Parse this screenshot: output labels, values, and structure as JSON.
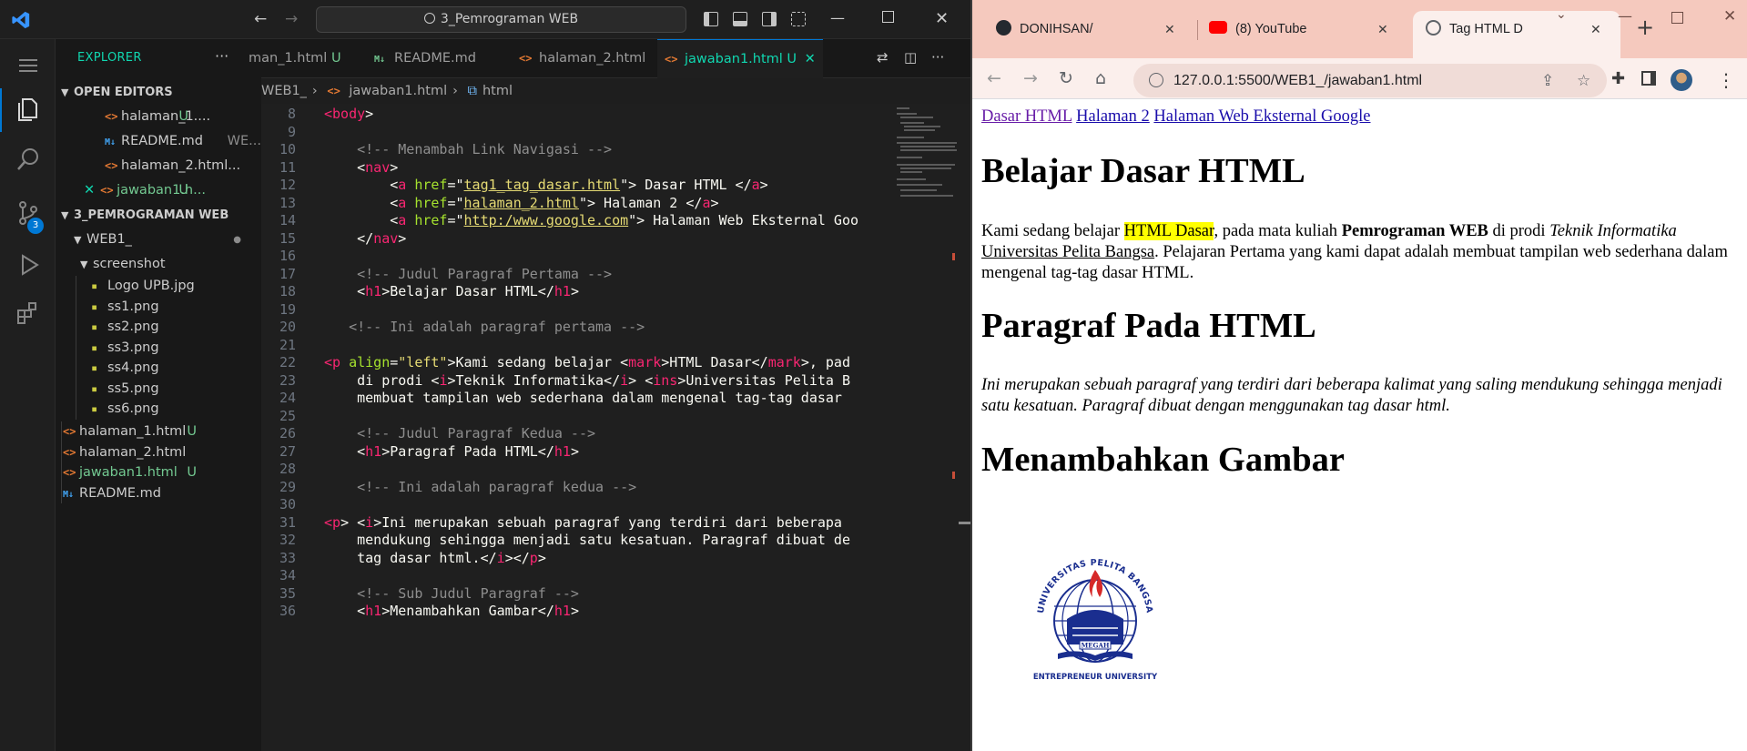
{
  "vscode": {
    "search_title": "3_Pemrograman WEB",
    "explorer_title": "EXPLORER",
    "open_editors_title": "OPEN EDITORS",
    "open_editors": [
      {
        "name": "halaman_1....",
        "flag": "U"
      },
      {
        "name": "README.md",
        "flag": "WE..."
      },
      {
        "name": "halaman_2.html...",
        "flag": ""
      },
      {
        "name": "jawaban1.h...",
        "flag": "U"
      }
    ],
    "project_title": "3_PEMROGRAMAN WEB",
    "folder_web1": "WEB1_",
    "folder_screenshot": "screenshot",
    "screenshot_files": [
      "Logo UPB.jpg",
      "ss1.png",
      "ss2.png",
      "ss3.png",
      "ss4.png",
      "ss5.png",
      "ss6.png"
    ],
    "root_files": [
      {
        "name": "halaman_1.html",
        "flag": "U"
      },
      {
        "name": "halaman_2.html",
        "flag": ""
      },
      {
        "name": "jawaban1.html",
        "flag": "U"
      },
      {
        "name": "README.md",
        "flag": ""
      }
    ],
    "scm_badge": "3",
    "tabs": [
      {
        "name": "man_1.html",
        "flag": "U"
      },
      {
        "name": "README.md",
        "flag": ""
      },
      {
        "name": "halaman_2.html",
        "flag": ""
      },
      {
        "name": "jawaban1.html",
        "flag": "U"
      }
    ],
    "breadcrumb": [
      "WEB1_",
      "jawaban1.html",
      "html"
    ],
    "code_lines": [
      {
        "n": "8",
        "segs": [
          [
            "t-tag",
            "<body"
          ],
          [
            "t-txt",
            ">"
          ]
        ]
      },
      {
        "n": "9",
        "segs": []
      },
      {
        "n": "10",
        "segs": [
          [
            "t-com",
            "    <!-- Menambah Link Navigasi -->"
          ]
        ]
      },
      {
        "n": "11",
        "segs": [
          [
            "t-txt",
            "    <"
          ],
          [
            "t-tag",
            "nav"
          ],
          [
            "t-txt",
            ">"
          ]
        ]
      },
      {
        "n": "12",
        "segs": [
          [
            "t-txt",
            "        <"
          ],
          [
            "t-tag",
            "a"
          ],
          [
            "t-txt",
            " "
          ],
          [
            "t-attr",
            "href"
          ],
          [
            "t-txt",
            "=\""
          ],
          [
            "t-str-u",
            "tag1_tag_dasar.html"
          ],
          [
            "t-txt",
            "\"> Dasar HTML </"
          ],
          [
            "t-tag",
            "a"
          ],
          [
            "t-txt",
            ">"
          ]
        ]
      },
      {
        "n": "13",
        "segs": [
          [
            "t-txt",
            "        <"
          ],
          [
            "t-tag",
            "a"
          ],
          [
            "t-txt",
            " "
          ],
          [
            "t-attr",
            "href"
          ],
          [
            "t-txt",
            "=\""
          ],
          [
            "t-str-u",
            "halaman_2.html"
          ],
          [
            "t-txt",
            "\"> Halaman 2 </"
          ],
          [
            "t-tag",
            "a"
          ],
          [
            "t-txt",
            ">"
          ]
        ]
      },
      {
        "n": "14",
        "segs": [
          [
            "t-txt",
            "        <"
          ],
          [
            "t-tag",
            "a"
          ],
          [
            "t-txt",
            " "
          ],
          [
            "t-attr",
            "href"
          ],
          [
            "t-txt",
            "=\""
          ],
          [
            "t-str-u",
            "http:/www.google.com"
          ],
          [
            "t-txt",
            "\"> Halaman Web Eksternal Goo"
          ]
        ]
      },
      {
        "n": "15",
        "segs": [
          [
            "t-txt",
            "    </"
          ],
          [
            "t-tag",
            "nav"
          ],
          [
            "t-txt",
            ">"
          ]
        ]
      },
      {
        "n": "16",
        "segs": []
      },
      {
        "n": "17",
        "segs": [
          [
            "t-com",
            "    <!-- Judul Paragraf Pertama -->"
          ]
        ]
      },
      {
        "n": "18",
        "segs": [
          [
            "t-txt",
            "    <"
          ],
          [
            "t-tag",
            "h1"
          ],
          [
            "t-txt",
            ">Belajar Dasar HTML</"
          ],
          [
            "t-tag",
            "h1"
          ],
          [
            "t-txt",
            ">"
          ]
        ]
      },
      {
        "n": "19",
        "segs": []
      },
      {
        "n": "20",
        "segs": [
          [
            "t-com",
            "   <!-- Ini adalah paragraf pertama -->"
          ]
        ]
      },
      {
        "n": "21",
        "segs": []
      },
      {
        "n": "22",
        "segs": [
          [
            "t-tag",
            "<p"
          ],
          [
            "t-txt",
            " "
          ],
          [
            "t-attr",
            "align"
          ],
          [
            "t-txt",
            "="
          ],
          [
            "t-str",
            "\"left\""
          ],
          [
            "t-txt",
            ">Kami sedang belajar <"
          ],
          [
            "t-tag",
            "mark"
          ],
          [
            "t-txt",
            ">HTML Dasar</"
          ],
          [
            "t-tag",
            "mark"
          ],
          [
            "t-txt",
            ">, pad"
          ]
        ]
      },
      {
        "n": "23",
        "segs": [
          [
            "t-txt",
            "    di prodi <"
          ],
          [
            "t-tag",
            "i"
          ],
          [
            "t-txt",
            ">Teknik Informatika</"
          ],
          [
            "t-tag",
            "i"
          ],
          [
            "t-txt",
            "> <"
          ],
          [
            "t-tag",
            "ins"
          ],
          [
            "t-txt",
            ">Universitas Pelita B"
          ]
        ]
      },
      {
        "n": "24",
        "segs": [
          [
            "t-txt",
            "    membuat tampilan web sederhana dalam mengenal tag-tag dasar "
          ]
        ]
      },
      {
        "n": "25",
        "segs": []
      },
      {
        "n": "26",
        "segs": [
          [
            "t-com",
            "    <!-- Judul Paragraf Kedua -->"
          ]
        ]
      },
      {
        "n": "27",
        "segs": [
          [
            "t-txt",
            "    <"
          ],
          [
            "t-tag",
            "h1"
          ],
          [
            "t-txt",
            ">Paragraf Pada HTML</"
          ],
          [
            "t-tag",
            "h1"
          ],
          [
            "t-txt",
            ">"
          ]
        ]
      },
      {
        "n": "28",
        "segs": []
      },
      {
        "n": "29",
        "segs": [
          [
            "t-com",
            "    <!-- Ini adalah paragraf kedua -->"
          ]
        ]
      },
      {
        "n": "30",
        "segs": []
      },
      {
        "n": "31",
        "segs": [
          [
            "t-tag",
            "<p"
          ],
          [
            "t-txt",
            "> <"
          ],
          [
            "t-tag",
            "i"
          ],
          [
            "t-txt",
            ">Ini merupakan sebuah paragraf yang terdiri dari beberapa "
          ]
        ]
      },
      {
        "n": "32",
        "segs": [
          [
            "t-txt",
            "    mendukung sehingga menjadi satu kesatuan. Paragraf dibuat de"
          ]
        ]
      },
      {
        "n": "33",
        "segs": [
          [
            "t-txt",
            "    tag dasar html.</"
          ],
          [
            "t-tag",
            "i"
          ],
          [
            "t-txt",
            "></"
          ],
          [
            "t-tag",
            "p"
          ],
          [
            "t-txt",
            ">"
          ]
        ]
      },
      {
        "n": "34",
        "segs": []
      },
      {
        "n": "35",
        "segs": [
          [
            "t-com",
            "    <!-- Sub Judul Paragraf -->"
          ]
        ]
      },
      {
        "n": "36",
        "segs": [
          [
            "t-txt",
            "    <"
          ],
          [
            "t-tag",
            "h1"
          ],
          [
            "t-txt",
            ">Menambahkan Gambar</"
          ],
          [
            "t-tag",
            "h1"
          ],
          [
            "t-txt",
            ">"
          ]
        ]
      }
    ]
  },
  "chrome": {
    "tabs": [
      {
        "title": "DONIHSAN/",
        "favicon": "github-icon"
      },
      {
        "title": "(8) YouTube",
        "favicon": "youtube-icon"
      },
      {
        "title": "Tag HTML D",
        "favicon": "globe-icon"
      }
    ],
    "url": "127.0.0.1:5500/WEB1_/jawaban1.html",
    "page": {
      "nav_links": [
        "Dasar HTML",
        "Halaman 2",
        "Halaman Web Eksternal Google"
      ],
      "h1_first": "Belajar Dasar HTML",
      "p1_before": "Kami sedang belajar ",
      "p1_mark": "HTML Dasar",
      "p1_mid": ", pada mata kuliah ",
      "p1_bold": "Pemrograman WEB",
      "p1_mid2": " di prodi ",
      "p1_italic": "Teknik Informatika",
      "p1_ins": "Universitas Pelita Bangsa",
      "p1_after": ". Pelajaran Pertama yang kami dapat adalah membuat tampilan web sederhana dalam mengenal tag-tag dasar HTML.",
      "h1_second": "Paragraf Pada HTML",
      "p2": "Ini merupakan sebuah paragraf yang terdiri dari beberapa kalimat yang saling mendukung sehingga menjadi satu kesatuan. Paragraf dibuat dengan menggunakan tag dasar html.",
      "h1_third": "Menambahkan Gambar",
      "logo_ring_text": "UNIVERSITAS PELITA BANGSA",
      "logo_banner": "MEGAH",
      "logo_caption": "ENTREPRENEUR UNIVERSITY"
    }
  },
  "colors": {
    "vscode_accent": "#10d7b0",
    "html_tag": "#f92672",
    "html_attr": "#a6e22e",
    "html_string": "#e6db74",
    "chrome_frame": "#f5c9be",
    "link": "#1a0dab",
    "mark": "#ffff00"
  }
}
